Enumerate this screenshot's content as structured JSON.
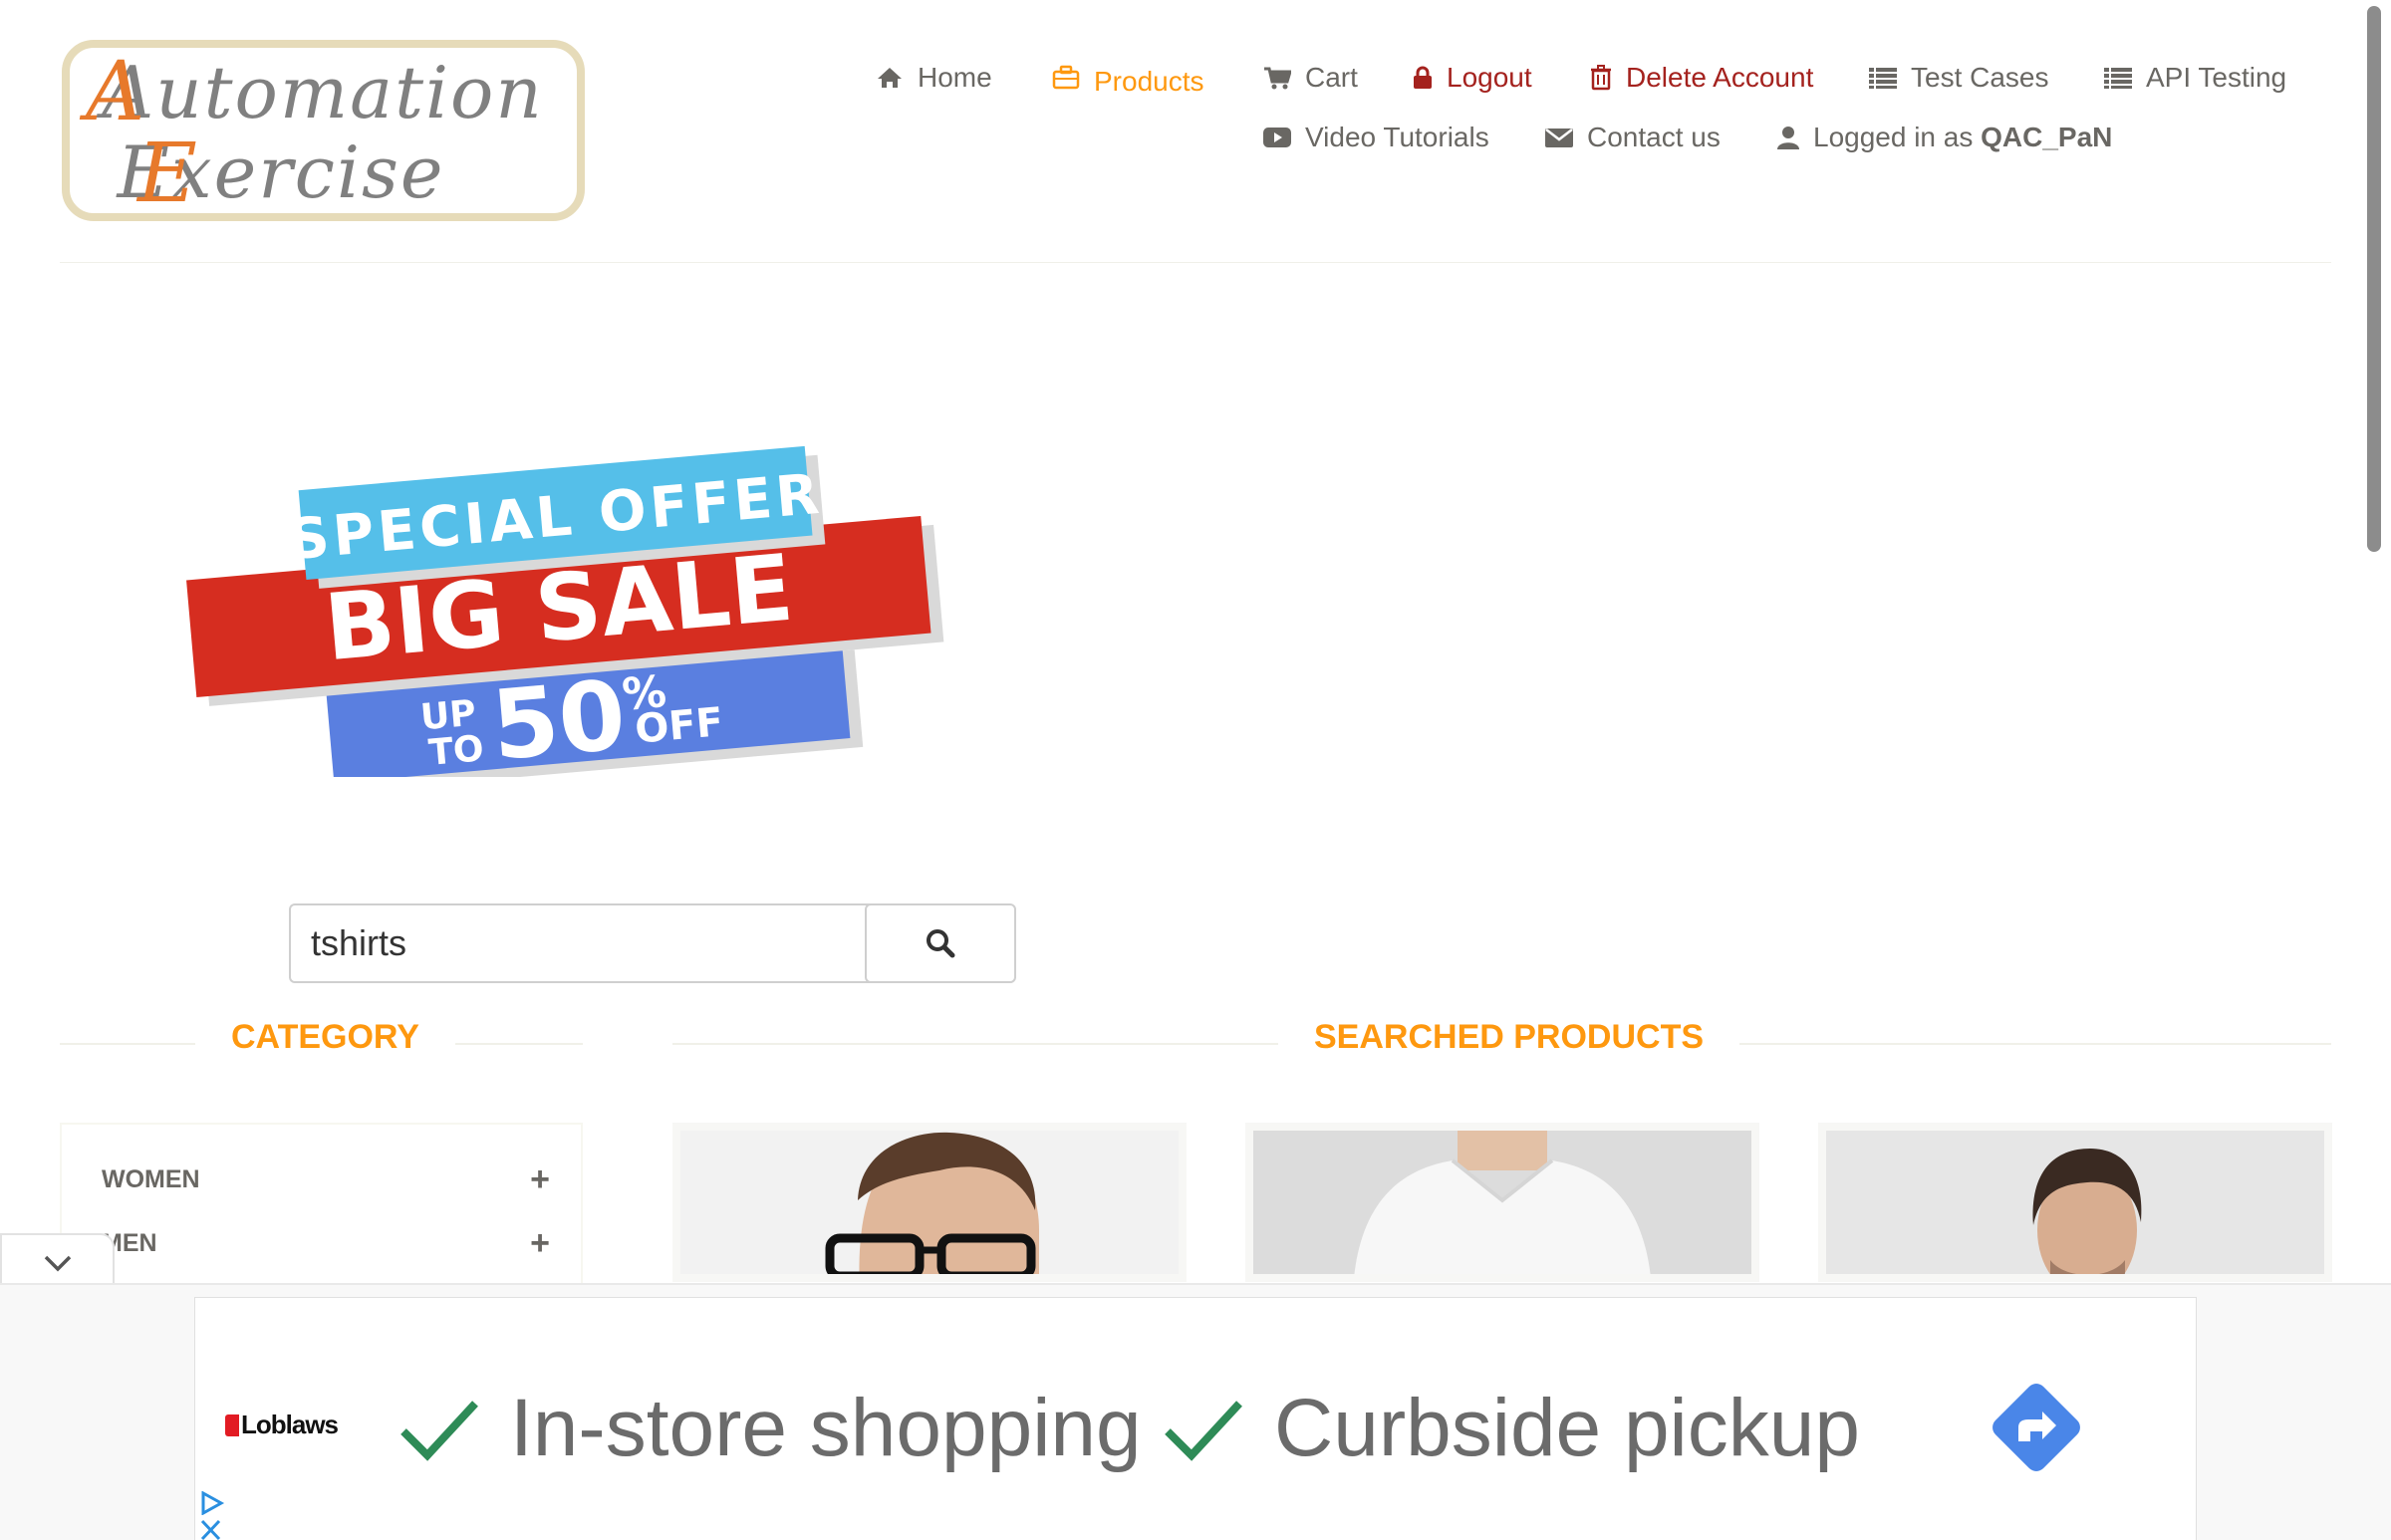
{
  "logo": {
    "line1": "Automation",
    "line2": "Exercise"
  },
  "nav": {
    "home": "Home",
    "products": "Products",
    "cart": "Cart",
    "logout": "Logout",
    "delete_account": "Delete Account",
    "test_cases": "Test Cases",
    "api_testing": "API Testing",
    "video_tutorials": "Video Tutorials",
    "contact_us": "Contact us",
    "logged_in_prefix": "Logged in as",
    "username": "QAC_PaN"
  },
  "banner": {
    "special_offer": "SPECIAL OFFER",
    "big_sale": "BIG SALE",
    "up": "UP",
    "to": "TO",
    "percent_value": "50",
    "percent_sign": "%",
    "off": "OFF"
  },
  "search": {
    "value": "tshirts"
  },
  "sections": {
    "category": "CATEGORY",
    "searched_products": "SEARCHED PRODUCTS"
  },
  "categories": [
    {
      "label": "WOMEN"
    },
    {
      "label": "MEN"
    }
  ],
  "ad": {
    "brand": "Loblaws",
    "item1": "In-store shopping",
    "item2": "Curbside pickup"
  },
  "colors": {
    "accent": "#FE980F",
    "danger": "#A4221E",
    "text": "#696763",
    "check_green": "#2E8B57",
    "ad_arrow_blue": "#4A86E8"
  }
}
